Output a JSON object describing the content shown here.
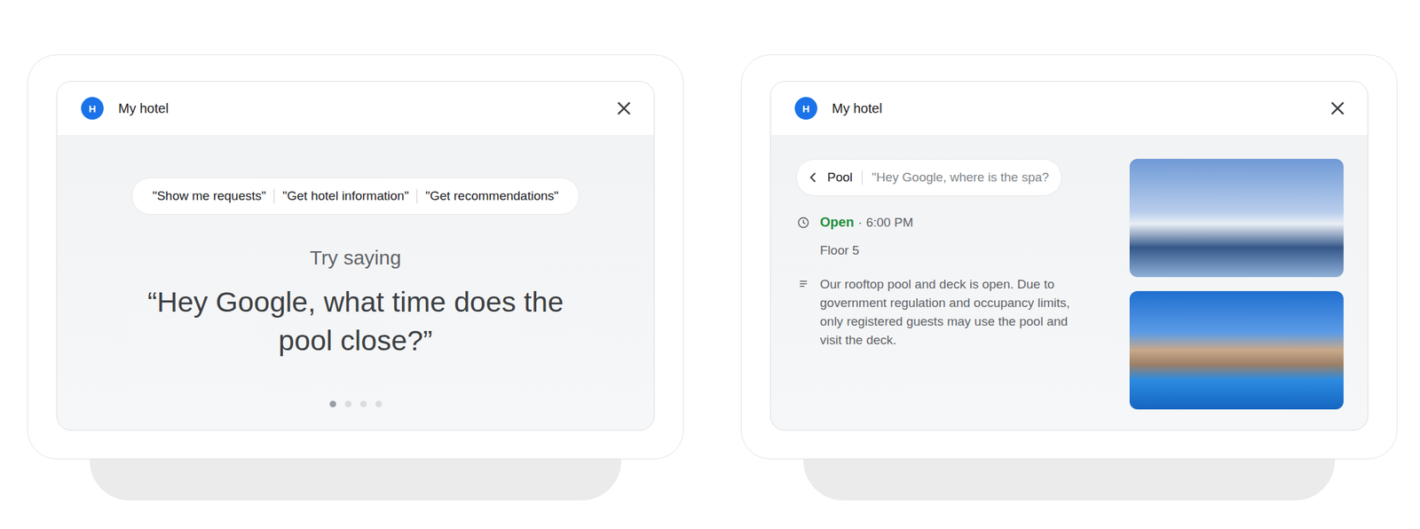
{
  "devices": [
    {
      "header": {
        "avatar": "H",
        "title": "My hotel"
      },
      "suggestions": [
        "\"Show me requests\"",
        "\"Get hotel information\"",
        "\"Get recommendations\""
      ],
      "prompt_label": "Try saying",
      "prompt": "“Hey Google, what time does the pool close?”",
      "pager": [
        {
          "selected": true
        },
        {
          "selected": false
        },
        {
          "selected": false
        },
        {
          "selected": false
        }
      ]
    },
    {
      "header": {
        "avatar": "H",
        "title": "My hotel"
      },
      "breadcrumb": {
        "label": "Pool",
        "query": "\"Hey Google, where is the spa?"
      },
      "status": "Open",
      "separator": "·",
      "hours": "6:00 PM",
      "floor": "Floor 5",
      "description": "Our rooftop pool and deck is open. Due to government regulation and occupancy limits, only registered guests may use the pool and visit the deck."
    }
  ]
}
